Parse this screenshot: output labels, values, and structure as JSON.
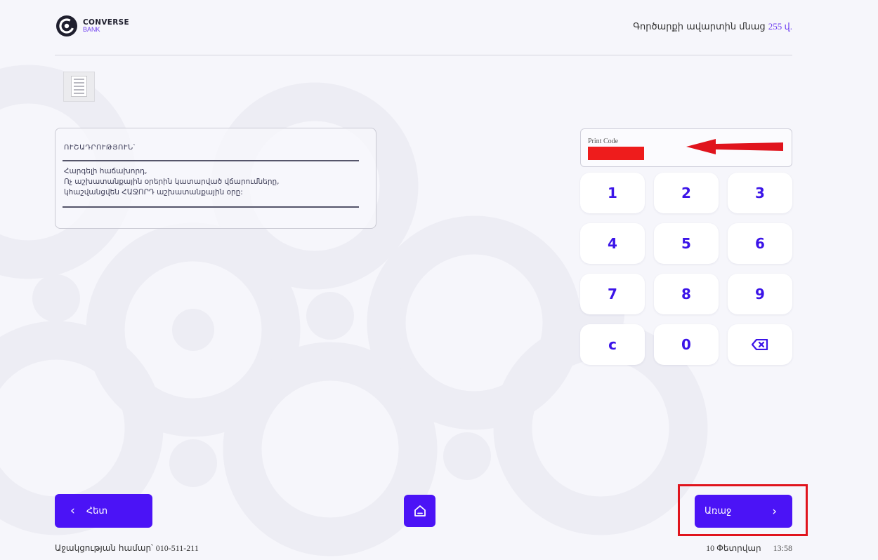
{
  "brand": {
    "name": "CONVERSE",
    "sub": "BANK",
    "accent": "#4b13f6"
  },
  "header": {
    "timer_prefix": "Գործարքի ավարտին մնաց",
    "timer_value": "255 վ."
  },
  "instruction": {
    "title": "ՈՒՇԱԴՐՈՒԹՅՈՒՆ՝",
    "line1": "Հարգելի հաճախորդ,",
    "line2": "Ոչ աշխատանքային օրերին կատարված վճարումները,",
    "line3": "կհաշվանցվեն ՀԱՋՈՐԴ աշխատանքային օրը:"
  },
  "print_code": {
    "label": "Print Code",
    "redacted_color": "#ee1c1c"
  },
  "keypad": {
    "k1": "1",
    "k2": "2",
    "k3": "3",
    "k4": "4",
    "k5": "5",
    "k6": "6",
    "k7": "7",
    "k8": "8",
    "k9": "9",
    "clear": "c",
    "k0": "0",
    "backspace_icon": "backspace-icon"
  },
  "footer": {
    "back_label": "Հետ",
    "next_label": "Առաջ",
    "home_icon": "home-icon",
    "help_label": "Աջակցության համար՝",
    "help_number": "010-511-211",
    "date": "10 Փետրվար",
    "time": "13:58"
  },
  "annotation": {
    "highlight_color": "#e0141d",
    "arrow_color": "#e0141d"
  }
}
